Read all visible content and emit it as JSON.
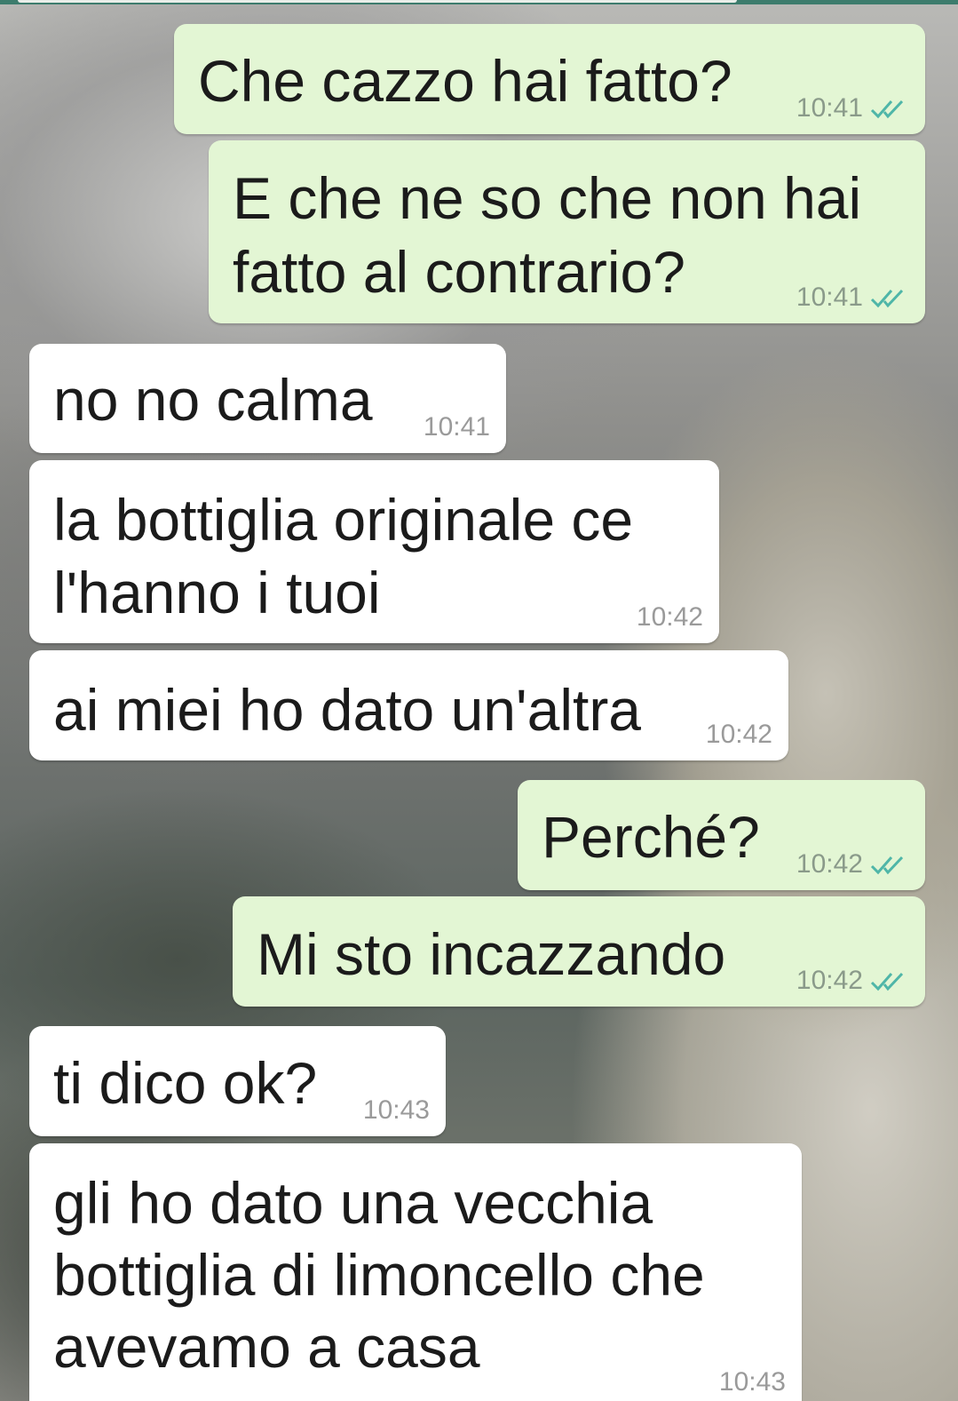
{
  "conversation": {
    "messages": [
      {
        "direction": "outgoing",
        "lines": [
          "Che cazzo hai fatto?"
        ],
        "time": "10:41",
        "status_icon": "double-check-icon"
      },
      {
        "direction": "outgoing",
        "lines": [
          "E che ne so che non hai",
          "fatto al contrario?"
        ],
        "time": "10:41",
        "status_icon": "double-check-icon"
      },
      {
        "direction": "incoming",
        "lines": [
          "no no calma"
        ],
        "time": "10:41"
      },
      {
        "direction": "incoming",
        "lines": [
          "la bottiglia originale ce",
          "l'hanno i tuoi"
        ],
        "time": "10:42"
      },
      {
        "direction": "incoming",
        "lines": [
          "ai miei ho dato un'altra"
        ],
        "time": "10:42"
      },
      {
        "direction": "outgoing",
        "lines": [
          "Perché?"
        ],
        "time": "10:42",
        "status_icon": "double-check-icon"
      },
      {
        "direction": "outgoing",
        "lines": [
          "Mi sto incazzando"
        ],
        "time": "10:42",
        "status_icon": "double-check-icon"
      },
      {
        "direction": "incoming",
        "lines": [
          "ti dico ok?"
        ],
        "time": "10:43"
      },
      {
        "direction": "incoming",
        "lines": [
          "gli ho dato una vecchia",
          "bottiglia di limoncello che",
          "avevamo a casa"
        ],
        "time": "10:43"
      }
    ]
  },
  "colors": {
    "outgoing_bubble": "#e3f6d4",
    "incoming_bubble": "#ffffff",
    "read_tick": "#4fb6a8"
  }
}
